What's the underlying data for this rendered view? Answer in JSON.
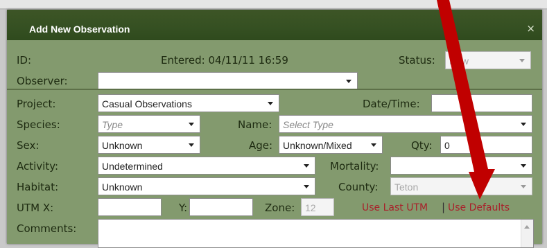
{
  "dialog": {
    "title": "Add New Observation",
    "close_glyph": "×"
  },
  "header": {
    "id_label": "ID:",
    "entered_text": "Entered: 04/11/11 16:59",
    "status_label": "Status:",
    "status_value": "New",
    "observer_label": "Observer:",
    "observer_value": ""
  },
  "form": {
    "project_label": "Project:",
    "project_value": "Casual Observations",
    "datetime_label": "Date/Time:",
    "datetime_value": "",
    "species_label": "Species:",
    "species_placeholder": "Type",
    "name_label": "Name:",
    "name_placeholder": "Select Type",
    "sex_label": "Sex:",
    "sex_value": "Unknown",
    "age_label": "Age:",
    "age_value": "Unknown/Mixed",
    "qty_label": "Qty:",
    "qty_value": "0",
    "activity_label": "Activity:",
    "activity_value": "Undetermined",
    "mortality_label": "Mortality:",
    "mortality_value": "",
    "habitat_label": "Habitat:",
    "habitat_value": "Unknown",
    "county_label": "County:",
    "county_value": "Teton",
    "utmx_label": "UTM X:",
    "utmx_value": "",
    "y_label": "Y:",
    "y_value": "",
    "zone_label": "Zone:",
    "zone_value": "12",
    "use_last_utm": "Use Last UTM",
    "link_separator": "|",
    "use_defaults": "Use Defaults",
    "comments_label": "Comments:",
    "comments_value": ""
  },
  "colors": {
    "titlebar": "#355022",
    "panel": "#839a6e",
    "link": "#a8222b",
    "annotation_arrow": "#c00000"
  },
  "icons": {
    "close": "close-icon",
    "dropdown": "chevron-down-icon",
    "annotation": "red-arrow-annotation"
  }
}
